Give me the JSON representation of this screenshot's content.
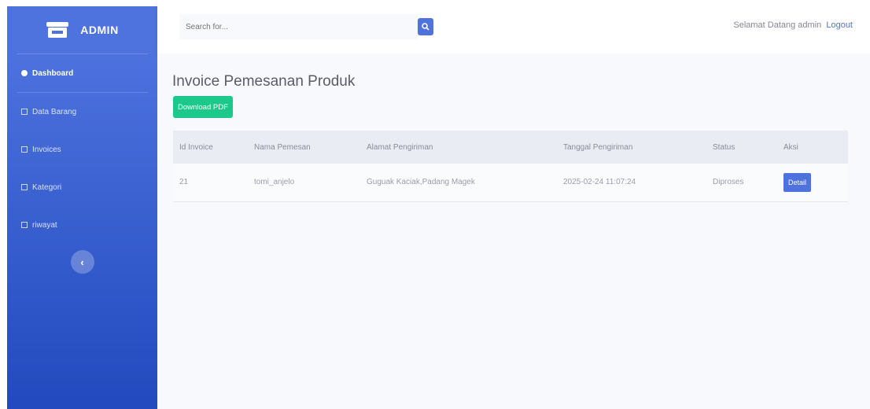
{
  "sidebar": {
    "brand": "ADMIN",
    "brand_icon": "store-icon",
    "items": [
      {
        "label": "Dashboard",
        "icon": "dashboard-icon"
      },
      {
        "label": "Data Barang",
        "icon": "table-icon"
      },
      {
        "label": "Invoices",
        "icon": "file-icon"
      },
      {
        "label": "Kategori",
        "icon": "table-icon"
      },
      {
        "label": "riwayat",
        "icon": "table-icon"
      }
    ],
    "toggle_icon": "chevron-left-icon"
  },
  "topbar": {
    "search_placeholder": "Search for...",
    "search_icon": "search-icon",
    "greeting": "Selamat Datang admin",
    "logout": "Logout"
  },
  "main": {
    "title": "Invoice Pemesanan Produk",
    "pdf_button": "Download PDF",
    "table": {
      "headers": [
        "Id Invoice",
        "Nama Pemesan",
        "Alamat Pengiriman",
        "Tanggal Pengiriman",
        "Status",
        "Aksi"
      ],
      "rows": [
        {
          "id": "21",
          "nama": "tomi_anjelo",
          "alamat": "Guguak Kaciak,Padang Magek",
          "tanggal": "2025-02-24 11:07:24",
          "status": "Diproses",
          "aksi": "Detail"
        }
      ]
    }
  },
  "colors": {
    "primary": "#4e73df",
    "success": "#1cc88a"
  }
}
